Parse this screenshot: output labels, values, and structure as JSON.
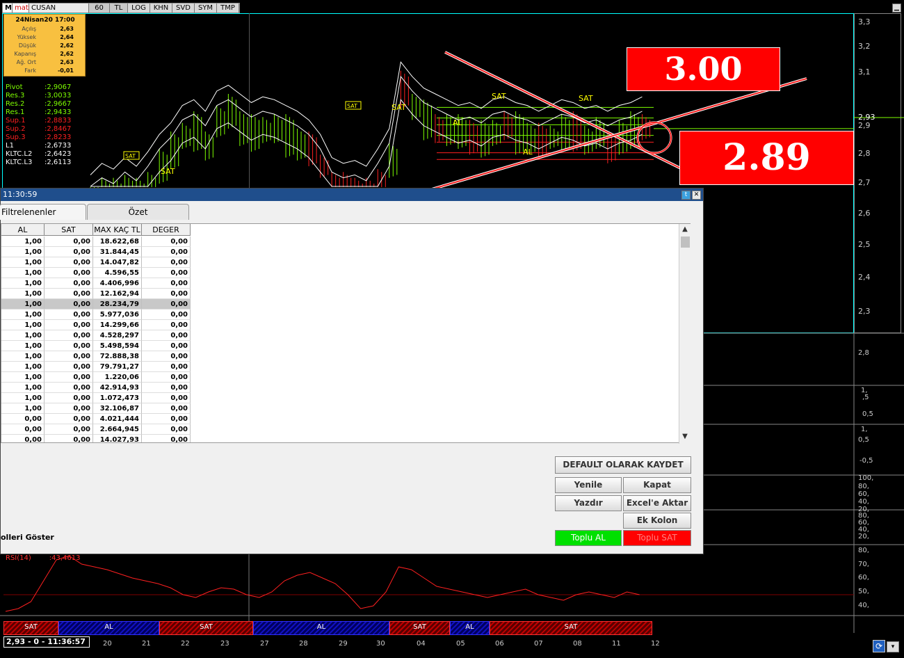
{
  "toolbar": {
    "m": "M",
    "logo": "matriks",
    "symbol": "CUSAN",
    "period": "60",
    "currency": "TL",
    "buttons": [
      "LOG",
      "KHN",
      "SVD",
      "SYM",
      "TMP"
    ]
  },
  "info": {
    "date": "24Nisan20 17:00",
    "rows": [
      {
        "label": "Açılış",
        "value": "2,63"
      },
      {
        "label": "Yüksek",
        "value": "2,64"
      },
      {
        "label": "Düşük",
        "value": "2,62"
      },
      {
        "label": "Kapanış",
        "value": "2,62"
      },
      {
        "label": "Ağ. Ort",
        "value": "2,63"
      },
      {
        "label": "Fark",
        "value": "-0,01"
      }
    ]
  },
  "levels": [
    {
      "label": "Pivot",
      "value": ":2,9067",
      "color": "#7fff00"
    },
    {
      "label": "Res.3",
      "value": ":3,0033",
      "color": "#7fff00"
    },
    {
      "label": "Res.2",
      "value": ":2,9667",
      "color": "#7fff00"
    },
    {
      "label": "Res.1",
      "value": ":2,9433",
      "color": "#7fff00"
    },
    {
      "label": "Sup.1",
      "value": ":2,8833",
      "color": "#ff2020"
    },
    {
      "label": "Sup.2",
      "value": ":2,8467",
      "color": "#ff2020"
    },
    {
      "label": "Sup.3",
      "value": ":2,8233",
      "color": "#ff2020"
    },
    {
      "label": "L1",
      "value": ":2,6733",
      "color": "#ffffff"
    },
    {
      "label": "KLTC.L2",
      "value": ":2,6423",
      "color": "#ffffff"
    },
    {
      "label": "KLTC.L3",
      "value": ":2,6113",
      "color": "#ffffff"
    }
  ],
  "price_axis": [
    "3,3",
    "3,2",
    "3,1",
    "2,93",
    "2,9",
    "2,8",
    "2,7",
    "2,6",
    "2,5",
    "2,4",
    "2,3"
  ],
  "callouts": {
    "top": "3.00",
    "bottom": "2.89"
  },
  "chart_labels": {
    "sat": "SAT",
    "al": "AL"
  },
  "sub_axes": {
    "p1": [
      "2,8"
    ],
    "p2": [
      "1,",
      ",5",
      "0,5"
    ],
    "p3": [
      "1,",
      "0,5",
      "-0,5"
    ],
    "p4": [
      "100,",
      "80,",
      "60,",
      "40,",
      "20,"
    ],
    "p5": [
      "80,",
      "60,",
      "40,",
      "20,"
    ],
    "rsi": [
      "80,",
      "70,",
      "60,",
      "50,",
      "40,"
    ]
  },
  "dialog": {
    "title": "11:30:59",
    "tabs": [
      "Filtrelenenler",
      "Özet"
    ],
    "columns": [
      "AL",
      "SAT",
      "MAX KAÇ TL",
      "DEGER"
    ],
    "rows": [
      [
        "1,00",
        "0,00",
        "18.622,68",
        "0,00"
      ],
      [
        "1,00",
        "0,00",
        "31.844,45",
        "0,00"
      ],
      [
        "1,00",
        "0,00",
        "14.047,82",
        "0,00"
      ],
      [
        "1,00",
        "0,00",
        "4.596,55",
        "0,00"
      ],
      [
        "1,00",
        "0,00",
        "4.406,996",
        "0,00"
      ],
      [
        "1,00",
        "0,00",
        "12.162,94",
        "0,00"
      ],
      [
        "1,00",
        "0,00",
        "28.234,79",
        "0,00"
      ],
      [
        "1,00",
        "0,00",
        "5.977,036",
        "0,00"
      ],
      [
        "1,00",
        "0,00",
        "14.299,66",
        "0,00"
      ],
      [
        "1,00",
        "0,00",
        "4.528,297",
        "0,00"
      ],
      [
        "1,00",
        "0,00",
        "5.498,594",
        "0,00"
      ],
      [
        "1,00",
        "0,00",
        "72.888,38",
        "0,00"
      ],
      [
        "1,00",
        "0,00",
        "79.791,27",
        "0,00"
      ],
      [
        "1,00",
        "0,00",
        "1.220,06",
        "0,00"
      ],
      [
        "1,00",
        "0,00",
        "42.914,93",
        "0,00"
      ],
      [
        "1,00",
        "0,00",
        "1.072,473",
        "0,00"
      ],
      [
        "1,00",
        "0,00",
        "32.106,87",
        "0,00"
      ],
      [
        "0,00",
        "0,00",
        "4.021,444",
        "0,00"
      ],
      [
        "0,00",
        "0,00",
        "2.664,945",
        "0,00"
      ],
      [
        "0,00",
        "0,00",
        "14.027,93",
        "0,00"
      ]
    ],
    "selected_row": 6,
    "buttons": {
      "default_save": "DEFAULT OLARAK KAYDET",
      "refresh": "Yenile",
      "close": "Kapat",
      "print": "Yazdır",
      "excel": "Excel'e Aktar",
      "extra_cols": "Ek Kolon Seçimi",
      "bulk_buy": "Toplu AL",
      "bulk_sell": "Toplu SAT"
    },
    "show_label": "olleri Göster"
  },
  "rsi": {
    "label": "RSI(14)",
    "value": ":43,4613"
  },
  "signals": [
    {
      "label": "SAT",
      "type": "sat"
    },
    {
      "label": "AL",
      "type": "al"
    },
    {
      "label": "SAT",
      "type": "sat"
    },
    {
      "label": "AL",
      "type": "al"
    },
    {
      "label": "SAT",
      "type": "sat"
    },
    {
      "label": "AL",
      "type": "al"
    },
    {
      "label": "SAT",
      "type": "sat"
    }
  ],
  "status": "2,93 - 0 - 11:36:57",
  "dates": [
    "20",
    "21",
    "22",
    "23",
    "27",
    "28",
    "29",
    "30",
    "04",
    "05",
    "06",
    "07",
    "08",
    "11",
    "12"
  ]
}
